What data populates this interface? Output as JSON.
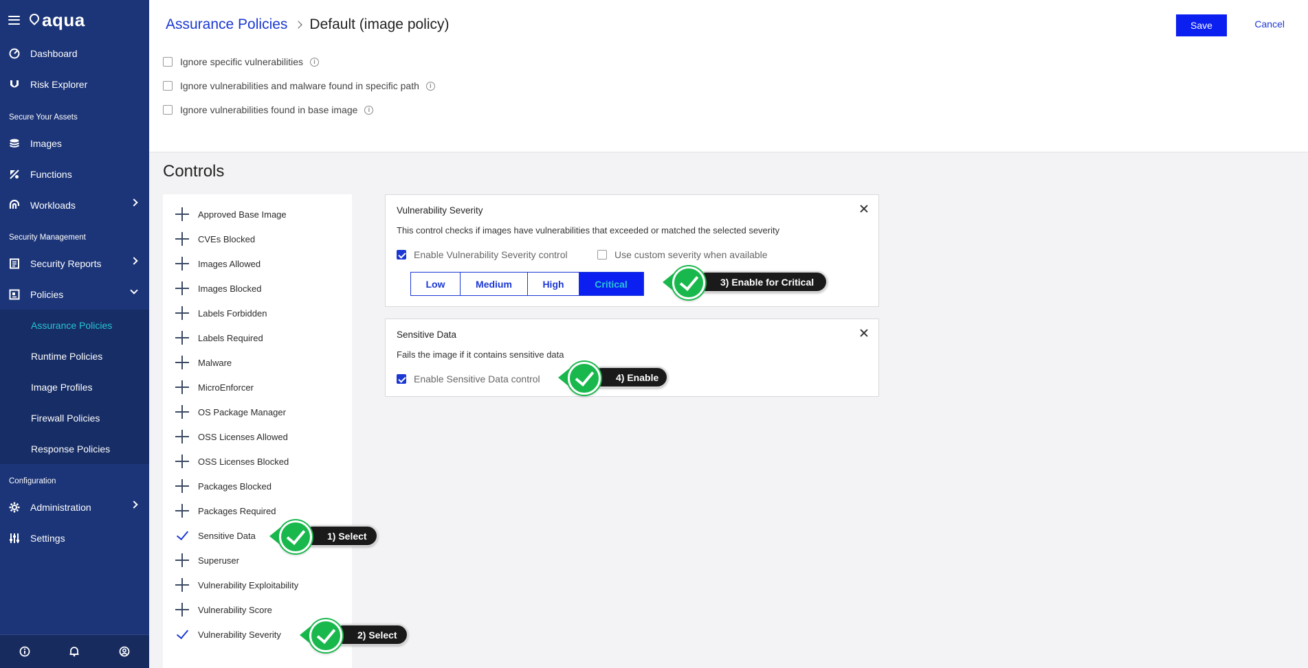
{
  "app": {
    "logo_text": "aqua"
  },
  "sidebar": {
    "items": [
      {
        "label": "Dashboard",
        "icon": "gauge-icon"
      },
      {
        "label": "Risk Explorer",
        "icon": "risk-explorer-icon"
      }
    ],
    "section_secure": "Secure Your Assets",
    "secure_items": [
      {
        "label": "Images",
        "icon": "layers-icon"
      },
      {
        "label": "Functions",
        "icon": "functions-icon"
      },
      {
        "label": "Workloads",
        "icon": "workloads-icon"
      }
    ],
    "section_security": "Security Management",
    "security_items": [
      {
        "label": "Security Reports",
        "icon": "report-icon"
      },
      {
        "label": "Policies",
        "icon": "policies-icon"
      }
    ],
    "policy_sub_items": [
      {
        "label": "Assurance Policies",
        "active": true
      },
      {
        "label": "Runtime Policies",
        "active": false
      },
      {
        "label": "Image Profiles",
        "active": false
      },
      {
        "label": "Firewall Policies",
        "active": false
      },
      {
        "label": "Response Policies",
        "active": false
      }
    ],
    "section_config": "Configuration",
    "config_items": [
      {
        "label": "Administration",
        "icon": "gear-icon"
      },
      {
        "label": "Settings",
        "icon": "settings-icon"
      }
    ],
    "bottom_icons": [
      "info-icon",
      "bell-icon",
      "user-icon"
    ]
  },
  "header": {
    "breadcrumb_parent": "Assurance Policies",
    "breadcrumb_current": "Default (image policy)",
    "save_label": "Save",
    "cancel_label": "Cancel"
  },
  "ignore_options": [
    {
      "label": "Ignore specific vulnerabilities",
      "checked": false
    },
    {
      "label": "Ignore vulnerabilities and malware found in specific path",
      "checked": false
    },
    {
      "label": "Ignore vulnerabilities found in base image",
      "checked": false
    }
  ],
  "controls": {
    "title": "Controls",
    "list": [
      {
        "label": "Approved Base Image",
        "selected": false
      },
      {
        "label": "CVEs Blocked",
        "selected": false
      },
      {
        "label": "Images Allowed",
        "selected": false
      },
      {
        "label": "Images Blocked",
        "selected": false
      },
      {
        "label": "Labels Forbidden",
        "selected": false
      },
      {
        "label": "Labels Required",
        "selected": false
      },
      {
        "label": "Malware",
        "selected": false
      },
      {
        "label": "MicroEnforcer",
        "selected": false
      },
      {
        "label": "OS Package Manager",
        "selected": false
      },
      {
        "label": "OSS Licenses Allowed",
        "selected": false
      },
      {
        "label": "OSS Licenses Blocked",
        "selected": false
      },
      {
        "label": "Packages Blocked",
        "selected": false
      },
      {
        "label": "Packages Required",
        "selected": false
      },
      {
        "label": "Sensitive Data",
        "selected": true
      },
      {
        "label": "Superuser",
        "selected": false
      },
      {
        "label": "Vulnerability Exploitability",
        "selected": false
      },
      {
        "label": "Vulnerability Score",
        "selected": false
      },
      {
        "label": "Vulnerability Severity",
        "selected": true
      }
    ]
  },
  "vuln_card": {
    "title": "Vulnerability Severity",
    "description": "This control checks if images have vulnerabilities that exceeded or matched the selected severity",
    "enable_label": "Enable Vulnerability Severity control",
    "enable_checked": true,
    "custom_label": "Use custom severity when available",
    "custom_checked": false,
    "severities": [
      "Low",
      "Medium",
      "High",
      "Critical"
    ],
    "selected_severity": "Critical"
  },
  "sensitive_card": {
    "title": "Sensitive Data",
    "description": "Fails the image if it contains sensitive data",
    "enable_label": "Enable Sensitive Data control",
    "enable_checked": true
  },
  "callouts": {
    "c1": "1) Select",
    "c2": "2) Select",
    "c3": "3) Enable for Critical",
    "c4": "4) Enable"
  },
  "colors": {
    "sidebar_bg": "#1c3578",
    "accent_blue": "#0b1ff0",
    "active_cyan": "#27c5d6",
    "callout_green": "#19b84d"
  }
}
